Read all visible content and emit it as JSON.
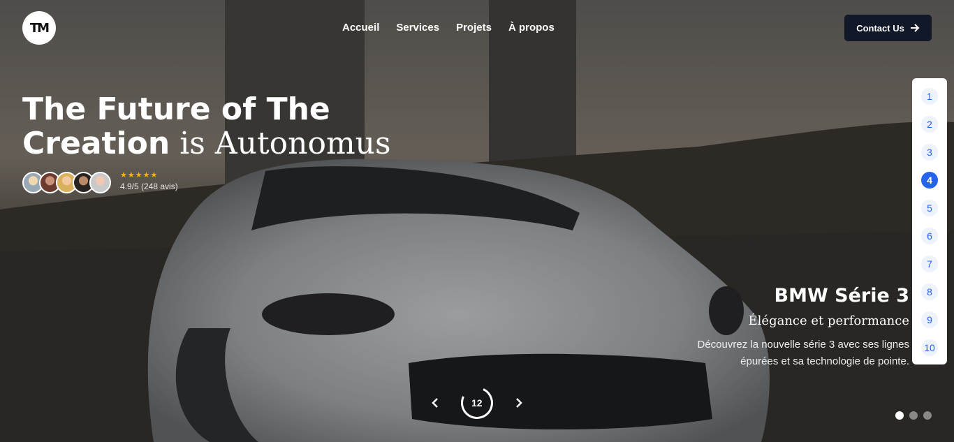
{
  "brand": {
    "logo_text": "TM"
  },
  "nav": [
    {
      "label": "Accueil"
    },
    {
      "label": "Services"
    },
    {
      "label": "Projets"
    },
    {
      "label": "À propos"
    }
  ],
  "contact": {
    "label": "Contact Us",
    "icon": "arrow-right-icon"
  },
  "hero": {
    "headline_line1": "The Future of The",
    "headline_bold": "Creation",
    "headline_serif": " is Autonomus",
    "stars": "★★★★★",
    "rating_text": "4.9/5 (248 avis)",
    "avatar_count": 5
  },
  "pager": [
    "1",
    "2",
    "3",
    "4",
    "5",
    "6",
    "7",
    "8",
    "9",
    "10"
  ],
  "pager_active": 3,
  "slide": {
    "title": "BMW Série 3",
    "subtitle": "Élégance et performance",
    "description_line1": "Découvrez la nouvelle série 3 avec ses lignes",
    "description_line2": "épurées et sa technologie de pointe."
  },
  "slider": {
    "prev_icon": "‹",
    "next_icon": "›",
    "counter": "12"
  },
  "dots_active": 0,
  "colors": {
    "accent": "#2563eb",
    "contact_bg": "#111827",
    "stars": "#f5b700"
  }
}
